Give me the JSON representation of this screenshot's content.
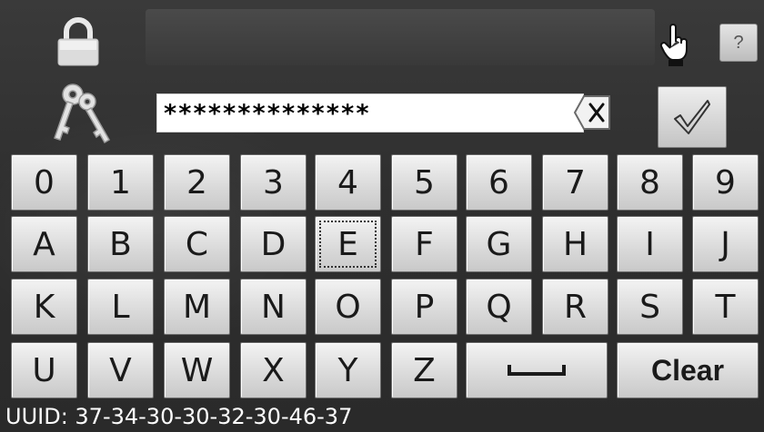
{
  "icons": {
    "lock": "lock-icon",
    "hand": "hand-pointer-icon",
    "help": "question-icon",
    "keys": "keys-icon",
    "clear_field": "backspace-x-icon",
    "ok": "checkmark-icon"
  },
  "password": {
    "masked_value": "**************"
  },
  "help_button": {
    "label": "?"
  },
  "keys": {
    "row0": [
      "0",
      "1",
      "2",
      "3",
      "4",
      "5",
      "6",
      "7",
      "8",
      "9"
    ],
    "row1": [
      "A",
      "B",
      "C",
      "D",
      "E",
      "F",
      "G",
      "H",
      "I",
      "J"
    ],
    "row2": [
      "K",
      "L",
      "M",
      "N",
      "O",
      "P",
      "Q",
      "R",
      "S",
      "T"
    ],
    "row3": [
      "U",
      "V",
      "W",
      "X",
      "Y",
      "Z"
    ],
    "space": "space",
    "clear": "Clear",
    "focused": "E"
  },
  "uuid": {
    "text": "UUID: 37-34-30-30-32-30-46-37"
  },
  "colors": {
    "background": "#333333",
    "key_face": "#d9d9d9",
    "text_on_dark": "#ffffff"
  }
}
